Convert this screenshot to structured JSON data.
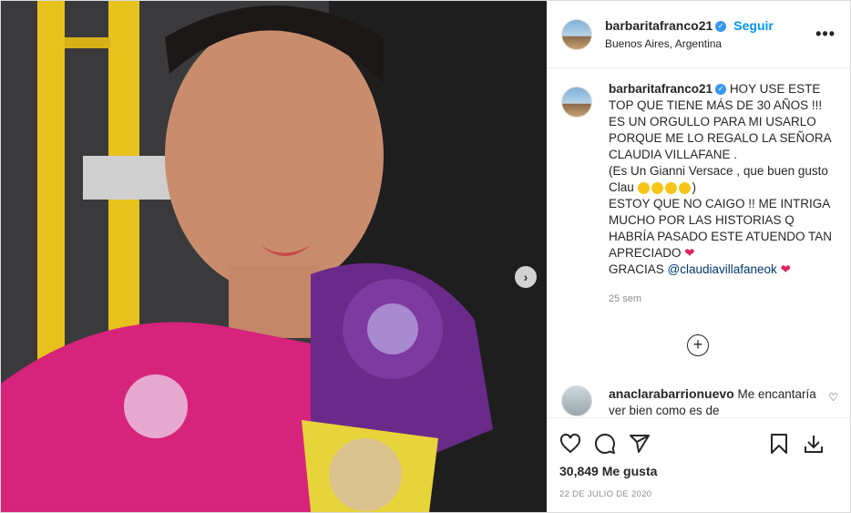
{
  "post": {
    "username": "barbaritafranco21",
    "follow_label": "Seguir",
    "location": "Buenos Aires, Argentina",
    "more_label": "•••",
    "next_label": "›"
  },
  "caption": {
    "username": "barbaritafranco21",
    "line1": "HOY USE ESTE TOP QUE TIENE MÁS DE 30 AÑOS !!! ES UN ORGULLO PARA MI USARLO PORQUE ME LO REGALO LA SEÑORA CLAUDIA VILLAFANE .",
    "line2": "(Es Un Gianni Versace , que buen gusto Clau",
    "line2_end": ")",
    "line3": "ESTOY QUE NO CAIGO !! ME INTRIGA MUCHO POR LAS HISTORIAS Q HABRÍA PASADO ESTE ATUENDO TAN APRECIADO",
    "line4_prefix": "GRACIAS",
    "mention": "@claudiavillafaneok",
    "heart": "❤",
    "time": "25 sem"
  },
  "load_more": "+",
  "comment2": {
    "username": "anaclarabarrionuevo",
    "text": "Me encantaría ver bien como es de"
  },
  "actions": {
    "likes": "30,849 Me gusta",
    "date": "22 DE JULIO DE 2020"
  },
  "colors": {
    "accent": "#0095f6",
    "verified": "#3897f0",
    "heart": "#e0245e"
  }
}
